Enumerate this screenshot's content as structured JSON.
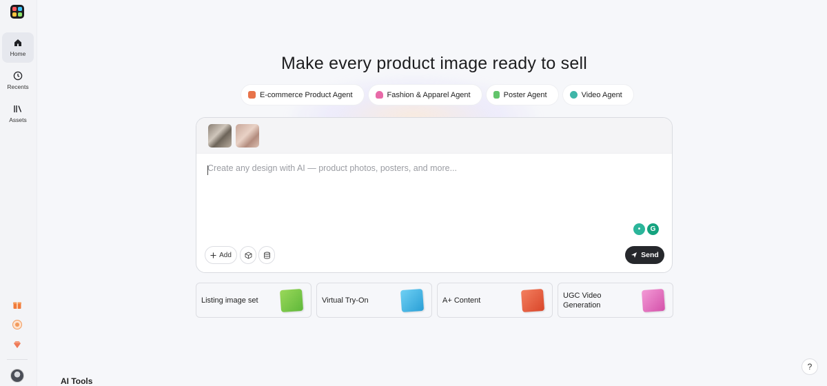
{
  "sidebar": {
    "items": [
      {
        "label": "Home",
        "icon": "home-icon",
        "active": true
      },
      {
        "label": "Recents",
        "icon": "clock-icon"
      },
      {
        "label": "Assets",
        "icon": "library-icon"
      }
    ],
    "bottom_icons": [
      "gift-icon",
      "coin-icon",
      "gem-icon"
    ]
  },
  "main": {
    "headline": "Make every product image ready to sell",
    "agents": [
      {
        "label": "E-commerce Product Agent",
        "color": "#e8734a"
      },
      {
        "label": "Fashion & Apparel Agent",
        "color": "#e86aa8"
      },
      {
        "label": "Poster Agent",
        "color": "#62c46b"
      },
      {
        "label": "Video Agent",
        "color": "#3fb6a8"
      }
    ],
    "composer": {
      "placeholder": "Create any design with AI — product photos, posters, and more...",
      "value": "",
      "add_label": "Add",
      "send_label": "Send"
    },
    "feature_cards": [
      {
        "label": "Listing image set",
        "accent": "#7cc943"
      },
      {
        "label": "Virtual Try-On",
        "accent": "#3eb7e6"
      },
      {
        "label": "A+ Content",
        "accent": "#e85a3a"
      },
      {
        "label": "UGC Video Generation",
        "accent": "#e46ab8"
      }
    ],
    "section_title": "AI Tools"
  },
  "help_label": "?"
}
